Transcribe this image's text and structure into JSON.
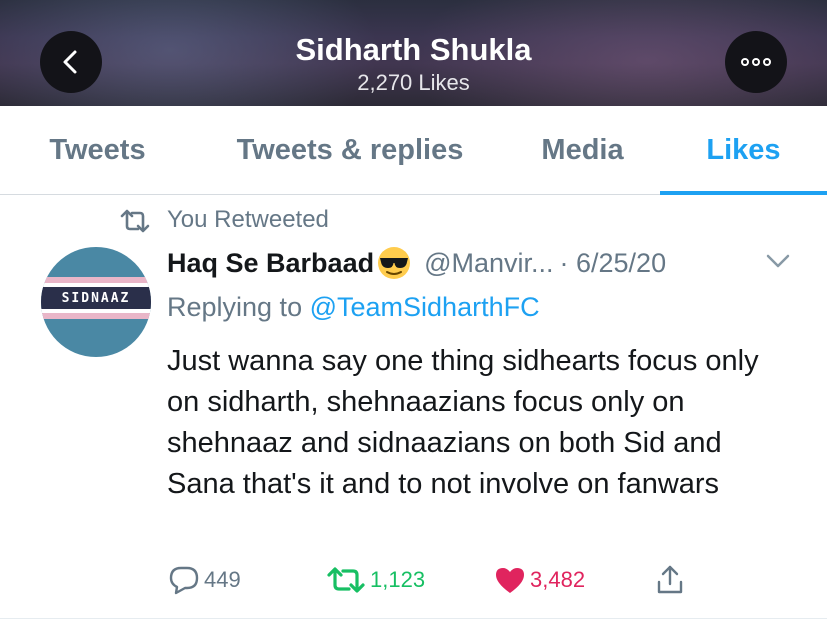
{
  "header": {
    "profile_name": "Sidharth Shukla",
    "likes_count": "2,270 Likes",
    "back_icon": "chevron-left-icon",
    "more_icon": "more-dots-icon"
  },
  "tabs": [
    {
      "label": "Tweets",
      "active": false
    },
    {
      "label": "Tweets & replies",
      "active": false
    },
    {
      "label": "Media",
      "active": false
    },
    {
      "label": "Likes",
      "active": true
    }
  ],
  "tweet": {
    "retweet_context": "You Retweeted",
    "author_name": "Haq Se Barbaad",
    "author_emoji": "smiling-face-with-sunglasses",
    "handle": "@Manvir...",
    "date": "· 6/25/20",
    "reply_prefix": "Replying to ",
    "reply_to": "@TeamSidharthFC",
    "text": "Just wanna say one thing sidhearts focus only on sidharth, shehnaazians focus only on shehnaaz and sidnaazians on both Sid and Sana that's it and to not involve on fanwars",
    "avatar_text": "SIDNAAZ",
    "replies": "449",
    "retweets": "1,123",
    "likes": "3,482"
  },
  "colors": {
    "accent": "#1da1f2",
    "secondary_text": "#657786",
    "retweet_green": "#17bf63",
    "like_red": "#e0245e"
  }
}
